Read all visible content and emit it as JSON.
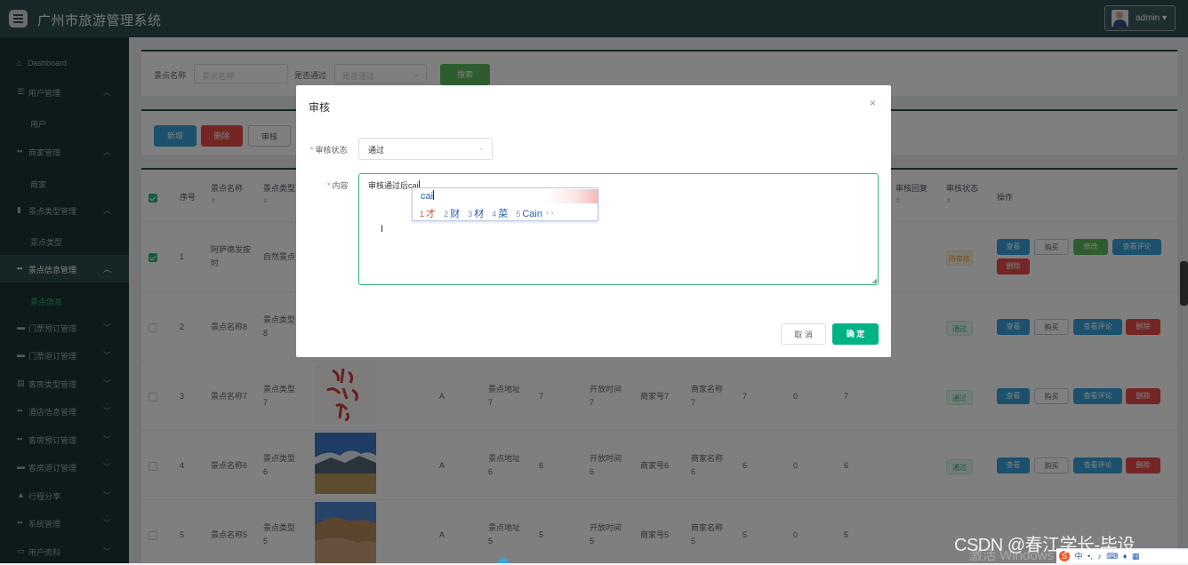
{
  "header": {
    "title": "广州市旅游管理系统",
    "user": "admin ▾"
  },
  "sidebar": {
    "items": [
      {
        "icon": "⌂",
        "label": "Dashboard",
        "chevron": ""
      },
      {
        "icon": "☰",
        "label": "用户管理",
        "chevron": "︿"
      },
      {
        "icon": "",
        "label": "用户",
        "chevron": ""
      },
      {
        "icon": "▪▪",
        "label": "商家管理",
        "chevron": "︿"
      },
      {
        "icon": "",
        "label": "商家",
        "chevron": ""
      },
      {
        "icon": "▮",
        "label": "景点类型管理",
        "chevron": "︿"
      },
      {
        "icon": "",
        "label": "景点类型",
        "chevron": ""
      },
      {
        "icon": "▪▪",
        "label": "景点信息管理",
        "chevron": "︿"
      },
      {
        "icon": "",
        "label": "景点信息",
        "chevron": ""
      },
      {
        "icon": "▬",
        "label": "门票预订管理",
        "chevron": "﹀"
      },
      {
        "icon": "▬",
        "label": "门票退订管理",
        "chevron": "﹀"
      },
      {
        "icon": "▤",
        "label": "客房类型管理",
        "chevron": "﹀"
      },
      {
        "icon": "▪▪",
        "label": "酒店信息管理",
        "chevron": "﹀"
      },
      {
        "icon": "▪▪",
        "label": "客房预订管理",
        "chevron": "﹀"
      },
      {
        "icon": "▬",
        "label": "客房退订管理",
        "chevron": "﹀"
      },
      {
        "icon": "▲",
        "label": "行程分享",
        "chevron": "﹀"
      },
      {
        "icon": "▪▪",
        "label": "系统管理",
        "chevron": "﹀"
      },
      {
        "icon": "▭",
        "label": "用户资料",
        "chevron": "﹀"
      }
    ]
  },
  "search": {
    "name_label": "景点名称",
    "name_placeholder": "景点名称",
    "pass_label": "是否通过",
    "pass_placeholder": "是否通过",
    "search_button": "搜索"
  },
  "toolbar": {
    "add": "新增",
    "delete": "删除",
    "audit": "审核"
  },
  "table": {
    "headers": {
      "index": "序号",
      "name": "景点名称",
      "type": "景点类型",
      "reply": "审核回复",
      "status": "审核状态",
      "ops": "操作"
    },
    "rows": [
      {
        "index": "1",
        "name": "阿萨德发按时",
        "type": "自然景点",
        "level": "",
        "address": "",
        "price": "",
        "open": "",
        "account": "",
        "merchant": "",
        "a": "",
        "b": "",
        "c": "",
        "status": "待审核",
        "ops": [
          "查看",
          "购买",
          "修改",
          "查看评论",
          "删除"
        ]
      },
      {
        "index": "2",
        "name": "景点名称8",
        "type": "景点类型8",
        "level": "",
        "address": "",
        "price": "",
        "open": "",
        "account": "",
        "merchant": "",
        "a": "",
        "b": "",
        "c": "",
        "status": "通过",
        "ops": [
          "查看",
          "购买",
          "查看评论",
          "删除"
        ]
      },
      {
        "index": "3",
        "name": "景点名称7",
        "type": "景点类型7",
        "level": "A",
        "address": "景点地址7",
        "price": "7",
        "open": "开放时间7",
        "account": "商家号7",
        "merchant": "商家名称7",
        "a": "7",
        "b": "0",
        "c": "7",
        "status": "通过",
        "ops": [
          "查看",
          "购买",
          "查看评论",
          "删除"
        ]
      },
      {
        "index": "4",
        "name": "景点名称6",
        "type": "景点类型6",
        "level": "A",
        "address": "景点地址6",
        "price": "6",
        "open": "开放时间6",
        "account": "商家号6",
        "merchant": "商家名称6",
        "a": "6",
        "b": "0",
        "c": "6",
        "status": "通过",
        "ops": [
          "查看",
          "购买",
          "查看评论",
          "删除"
        ]
      },
      {
        "index": "5",
        "name": "景点名称5",
        "type": "景点类型5",
        "level": "A",
        "address": "景点地址5",
        "price": "5",
        "open": "开放时间5",
        "account": "商家号5",
        "merchant": "商家名称5",
        "a": "5",
        "b": "0",
        "c": "5",
        "status": "",
        "ops": []
      }
    ]
  },
  "dialog": {
    "title": "审核",
    "close": "×",
    "status_label": "审核状态",
    "status_value": "通过",
    "content_label": "内容",
    "content_value": "审核通过后cai",
    "cancel": "取 消",
    "confirm": "确 定"
  },
  "ime": {
    "pinyin": "cai",
    "candidates": [
      {
        "n": "1",
        "text": "才"
      },
      {
        "n": "2",
        "text": "财"
      },
      {
        "n": "3",
        "text": "材"
      },
      {
        "n": "4",
        "text": "菜"
      },
      {
        "n": "5",
        "text": "Cain"
      }
    ],
    "pager": "‹ ›"
  },
  "watermark": "CSDN @春江学长-毕设",
  "activate": "激活 Windows",
  "tray": {
    "lang": "中",
    "punct": "•,",
    "mic": "♪"
  },
  "colors": {
    "header": "#2f4f4f",
    "sidebar": "#1c3232",
    "accent": "#2fb67a",
    "blue": "#36a3d9",
    "red": "#e84d4a"
  }
}
